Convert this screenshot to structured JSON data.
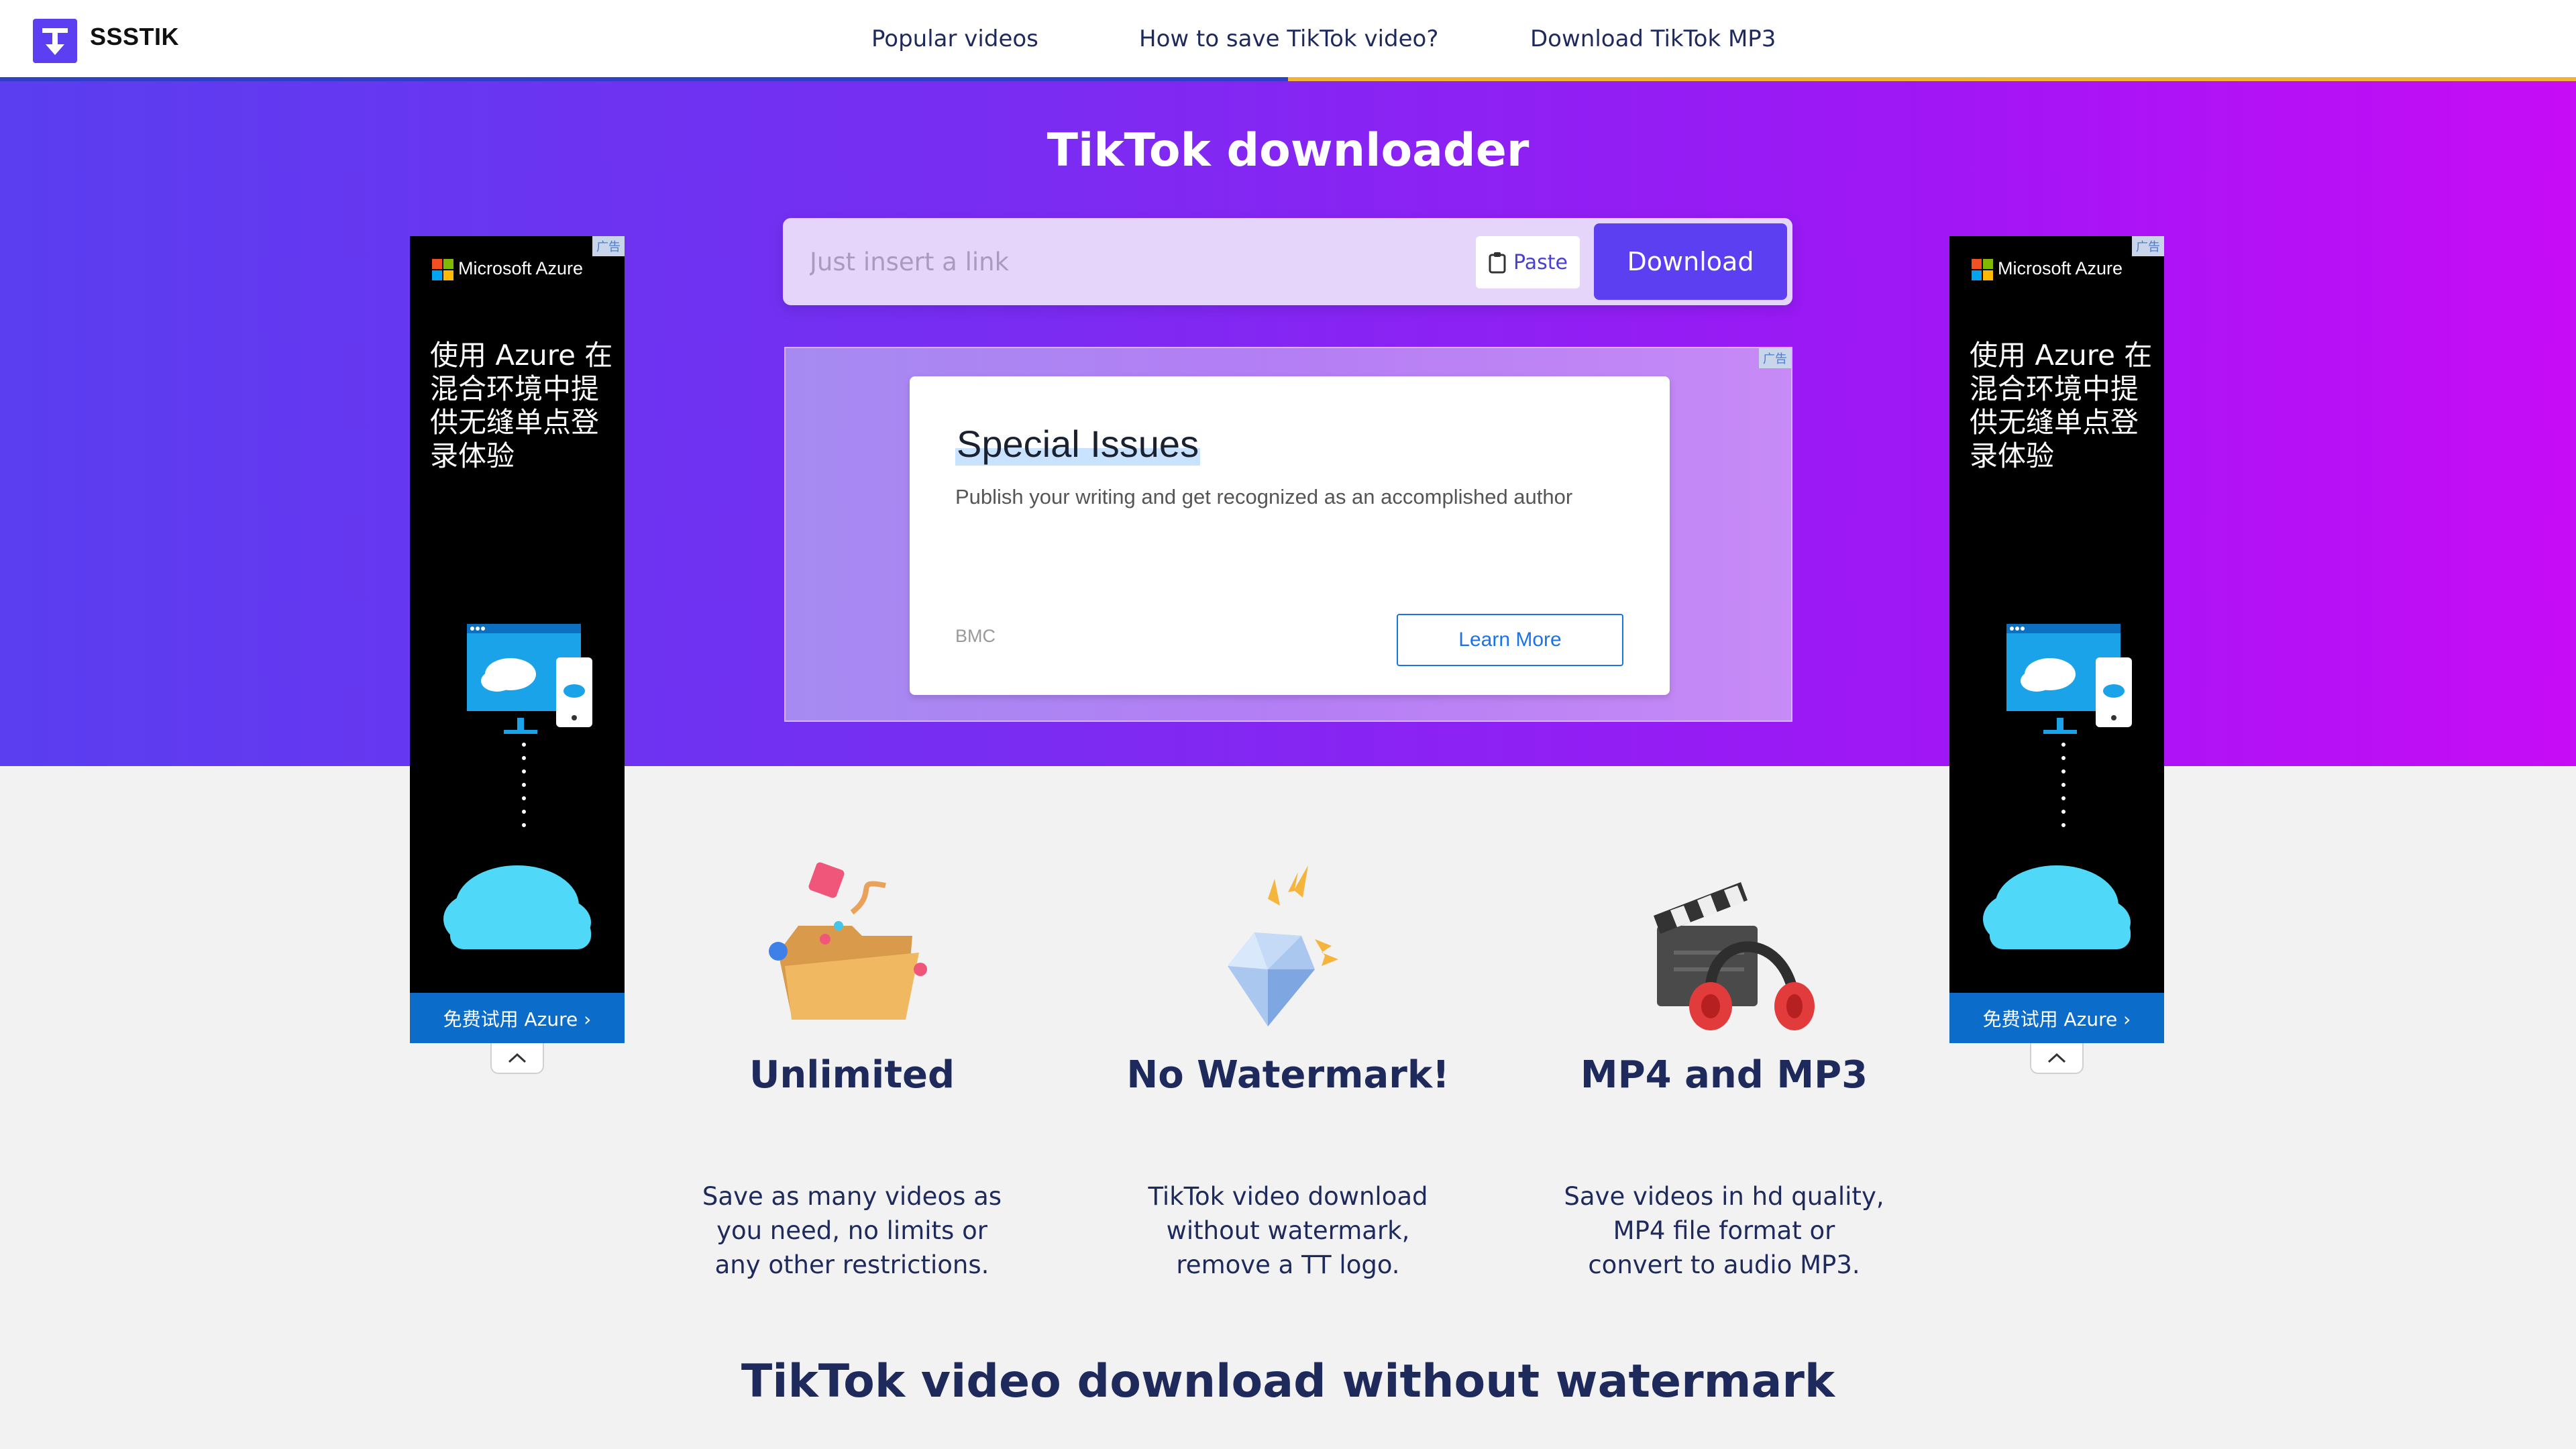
{
  "header": {
    "logo_text": "SSSTIK",
    "nav": [
      "Popular videos",
      "How to save TikTok video?",
      "Download TikTok MP3"
    ]
  },
  "hero": {
    "title": "TikTok downloader",
    "search_placeholder": "Just insert a link",
    "paste_label": "Paste",
    "download_label": "Download"
  },
  "ad_banner": {
    "corner_label": "广告",
    "title": "Special Issues",
    "subtitle": "Publish your writing and get recognized as an accomplished author",
    "brand": "BMC",
    "cta": "Learn More"
  },
  "side_ad": {
    "corner_label": "广告",
    "brand": "Microsoft Azure",
    "headline": "使用 Azure 在混合环境中提供无缝单点登录体验",
    "cta": "免费试用 Azure ›"
  },
  "features": [
    {
      "title": "Unlimited",
      "description": "Save as many videos as you need, no limits or any other restrictions.",
      "icon": "folder-icon"
    },
    {
      "title": "No Watermark!",
      "description": "TikTok video download without watermark, remove a TT logo.",
      "icon": "diamond-icon"
    },
    {
      "title": "MP4 and MP3",
      "description": "Save videos in hd quality, MP4 file format or convert to audio MP3.",
      "icon": "clapper-headphones-icon"
    }
  ],
  "bottom_title": "TikTok video download without watermark",
  "colors": {
    "brand": "#5b3ff0",
    "hero_gradient_start": "#5a3ef0",
    "hero_gradient_end": "#c70cf7",
    "text_dark": "#1f2a5c"
  }
}
